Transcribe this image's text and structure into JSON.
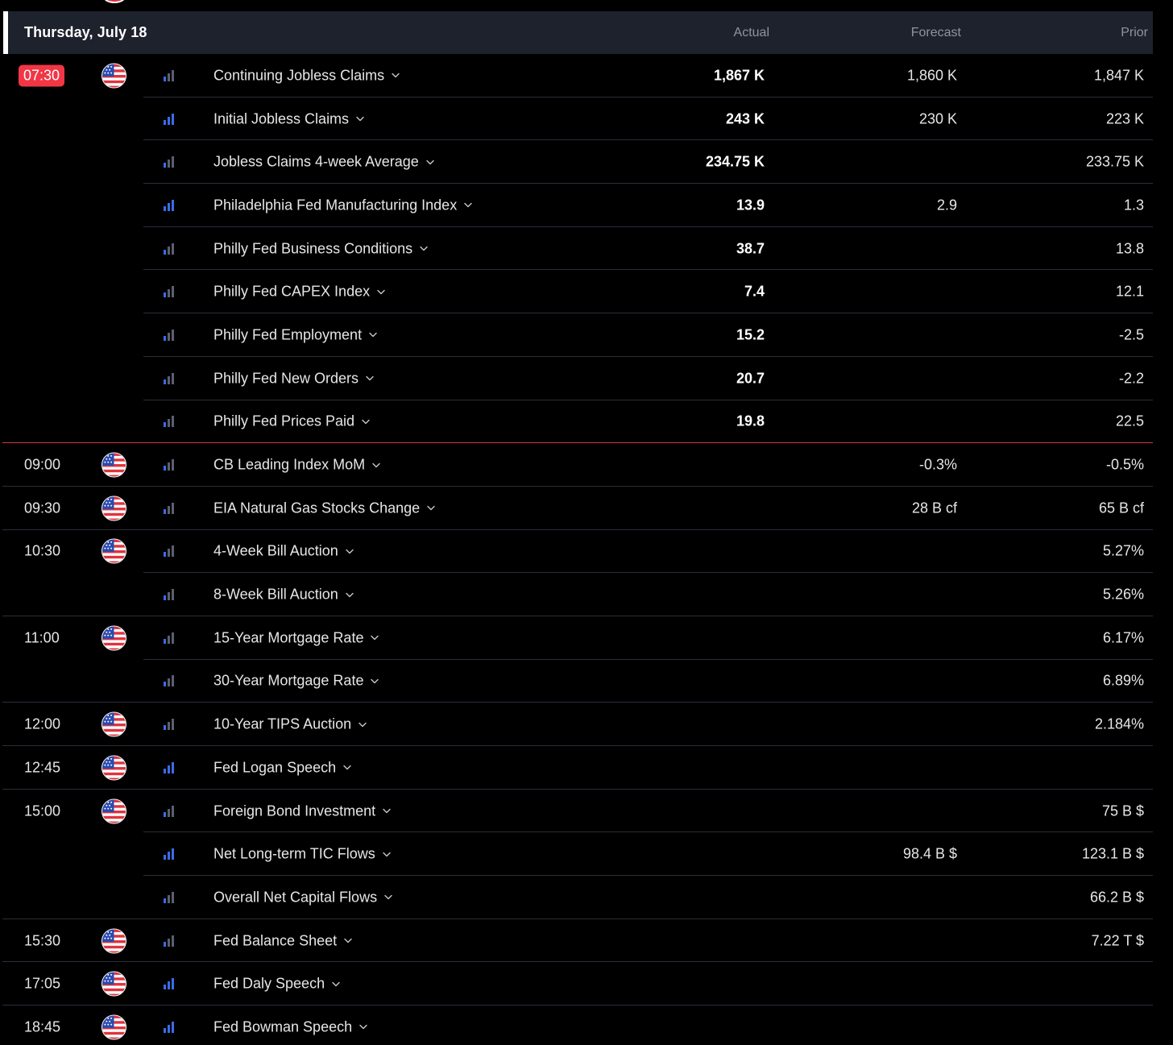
{
  "header": {
    "date": "Thursday, July 18",
    "col_actual": "Actual",
    "col_forecast": "Forecast",
    "col_prior": "Prior"
  },
  "colors": {
    "live_time_bg": "#f23645",
    "current_time_line": "#d23b3b",
    "importance_on": "#3b6ce8",
    "importance_off": "#5b6070",
    "header_bg": "#1e222d"
  },
  "rows": [
    {
      "time": "07:30",
      "live": true,
      "flag": true,
      "importance": 1,
      "name": "Continuing Jobless Claims",
      "actual": "1,867 K",
      "forecast": "1,860 K",
      "prior": "1,847 K",
      "sep": "part"
    },
    {
      "time": "",
      "flag": false,
      "importance": 3,
      "name": "Initial Jobless Claims",
      "actual": "243 K",
      "forecast": "230 K",
      "prior": "223 K",
      "sep": "part"
    },
    {
      "time": "",
      "flag": false,
      "importance": 1,
      "name": "Jobless Claims 4-week Average",
      "actual": "234.75 K",
      "forecast": "",
      "prior": "233.75 K",
      "sep": "part"
    },
    {
      "time": "",
      "flag": false,
      "importance": 3,
      "name": "Philadelphia Fed Manufacturing Index",
      "actual": "13.9",
      "forecast": "2.9",
      "prior": "1.3",
      "sep": "part"
    },
    {
      "time": "",
      "flag": false,
      "importance": 1,
      "name": "Philly Fed Business Conditions",
      "actual": "38.7",
      "forecast": "",
      "prior": "13.8",
      "sep": "part"
    },
    {
      "time": "",
      "flag": false,
      "importance": 1,
      "name": "Philly Fed CAPEX Index",
      "actual": "7.4",
      "forecast": "",
      "prior": "12.1",
      "sep": "part"
    },
    {
      "time": "",
      "flag": false,
      "importance": 1,
      "name": "Philly Fed Employment",
      "actual": "15.2",
      "forecast": "",
      "prior": "-2.5",
      "sep": "part"
    },
    {
      "time": "",
      "flag": false,
      "importance": 1,
      "name": "Philly Fed New Orders",
      "actual": "20.7",
      "forecast": "",
      "prior": "-2.2",
      "sep": "part"
    },
    {
      "time": "",
      "flag": false,
      "importance": 1,
      "name": "Philly Fed Prices Paid",
      "actual": "19.8",
      "forecast": "",
      "prior": "22.5",
      "sep": "red"
    },
    {
      "time": "09:00",
      "flag": true,
      "importance": 1,
      "name": "CB Leading Index MoM",
      "actual": "",
      "forecast": "-0.3%",
      "prior": "-0.5%",
      "sep": "full"
    },
    {
      "time": "09:30",
      "flag": true,
      "importance": 1,
      "name": "EIA Natural Gas Stocks Change",
      "actual": "",
      "forecast": "28 B cf",
      "prior": "65 B cf",
      "sep": "full"
    },
    {
      "time": "10:30",
      "flag": true,
      "importance": 1,
      "name": "4-Week Bill Auction",
      "actual": "",
      "forecast": "",
      "prior": "5.27%",
      "sep": "part"
    },
    {
      "time": "",
      "flag": false,
      "importance": 1,
      "name": "8-Week Bill Auction",
      "actual": "",
      "forecast": "",
      "prior": "5.26%",
      "sep": "full"
    },
    {
      "time": "11:00",
      "flag": true,
      "importance": 1,
      "name": "15-Year Mortgage Rate",
      "actual": "",
      "forecast": "",
      "prior": "6.17%",
      "sep": "part"
    },
    {
      "time": "",
      "flag": false,
      "importance": 1,
      "name": "30-Year Mortgage Rate",
      "actual": "",
      "forecast": "",
      "prior": "6.89%",
      "sep": "full"
    },
    {
      "time": "12:00",
      "flag": true,
      "importance": 1,
      "name": "10-Year TIPS Auction",
      "actual": "",
      "forecast": "",
      "prior": "2.184%",
      "sep": "full"
    },
    {
      "time": "12:45",
      "flag": true,
      "importance": 3,
      "name": "Fed Logan Speech",
      "actual": "",
      "forecast": "",
      "prior": "",
      "sep": "full"
    },
    {
      "time": "15:00",
      "flag": true,
      "importance": 1,
      "name": "Foreign Bond Investment",
      "actual": "",
      "forecast": "",
      "prior": "75 B $",
      "sep": "part"
    },
    {
      "time": "",
      "flag": false,
      "importance": 3,
      "name": "Net Long-term TIC Flows",
      "actual": "",
      "forecast": "98.4 B $",
      "prior": "123.1 B $",
      "sep": "part"
    },
    {
      "time": "",
      "flag": false,
      "importance": 1,
      "name": "Overall Net Capital Flows",
      "actual": "",
      "forecast": "",
      "prior": "66.2 B $",
      "sep": "full"
    },
    {
      "time": "15:30",
      "flag": true,
      "importance": 1,
      "name": "Fed Balance Sheet",
      "actual": "",
      "forecast": "",
      "prior": "7.22 T $",
      "sep": "full"
    },
    {
      "time": "17:05",
      "flag": true,
      "importance": 3,
      "name": "Fed Daly Speech",
      "actual": "",
      "forecast": "",
      "prior": "",
      "sep": "full"
    },
    {
      "time": "18:45",
      "flag": true,
      "importance": 3,
      "name": "Fed Bowman Speech",
      "actual": "",
      "forecast": "",
      "prior": "",
      "sep": "none"
    }
  ]
}
